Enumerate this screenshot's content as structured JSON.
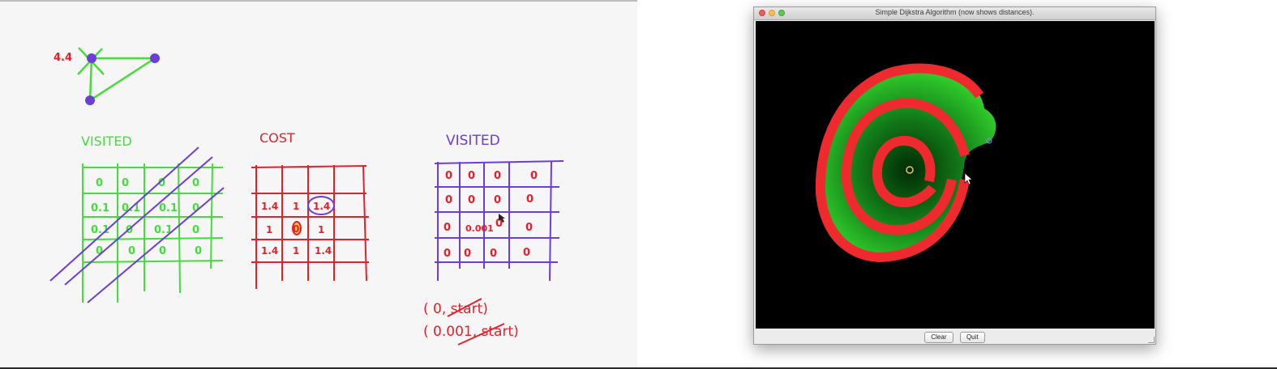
{
  "whiteboard": {
    "graph_label": "4.4",
    "left_grid": {
      "title": "VISITED",
      "rows": [
        [
          "0",
          "0",
          "0",
          "0"
        ],
        [
          "0.1",
          "0.1",
          "0.1",
          "0"
        ],
        [
          "0.1",
          "0",
          "0.1",
          "0"
        ],
        [
          "0",
          "0",
          "0",
          "0"
        ]
      ]
    },
    "cost_grid": {
      "title": "COST",
      "rows": [
        [
          "",
          "",
          "",
          ""
        ],
        [
          "1.4",
          "1",
          "1.4",
          ""
        ],
        [
          "1",
          "0",
          "1",
          ""
        ],
        [
          "1.4",
          "1",
          "1.4",
          ""
        ]
      ]
    },
    "right_grid": {
      "title": "VISITED",
      "rows": [
        [
          "0",
          "0",
          "0",
          "0"
        ],
        [
          "0",
          "0",
          "0",
          "0"
        ],
        [
          "0",
          "0.001",
          "0",
          "0"
        ],
        [
          "0",
          "0",
          "0",
          "0"
        ]
      ]
    },
    "note_line1": "( 0, start)",
    "note_line2": "( 0.001, start)"
  },
  "window": {
    "title": "Simple Dijkstra Algorithm (now shows distances).",
    "buttons": {
      "clear": "Clear",
      "quit": "Quit"
    }
  },
  "colors": {
    "green": "#44dd3b",
    "red": "#e4202c",
    "blue": "#6b3ed6",
    "canvas_bg": "#000000"
  }
}
